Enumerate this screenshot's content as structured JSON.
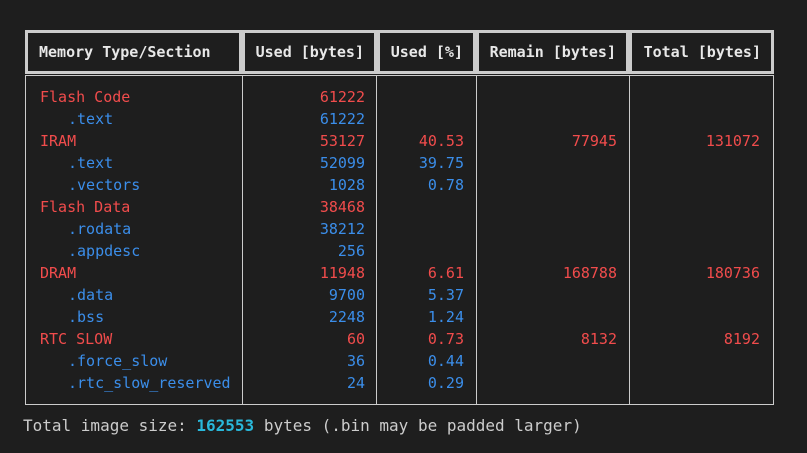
{
  "header": {
    "memory_type": "Memory Type/Section",
    "used_bytes": "Used [bytes]",
    "used_pct": "Used [%]",
    "remain_bytes": "Remain [bytes]",
    "total_bytes": "Total [bytes]"
  },
  "rows": [
    {
      "name": "Flash Code",
      "used": "61222",
      "pct": "",
      "remain": "",
      "total": "",
      "kind": "region"
    },
    {
      "name": ".text",
      "used": "61222",
      "pct": "",
      "remain": "",
      "total": "",
      "kind": "section"
    },
    {
      "name": "IRAM",
      "used": "53127",
      "pct": "40.53",
      "remain": "77945",
      "total": "131072",
      "kind": "region"
    },
    {
      "name": ".text",
      "used": "52099",
      "pct": "39.75",
      "remain": "",
      "total": "",
      "kind": "section"
    },
    {
      "name": ".vectors",
      "used": "1028",
      "pct": "0.78",
      "remain": "",
      "total": "",
      "kind": "section"
    },
    {
      "name": "Flash Data",
      "used": "38468",
      "pct": "",
      "remain": "",
      "total": "",
      "kind": "region"
    },
    {
      "name": ".rodata",
      "used": "38212",
      "pct": "",
      "remain": "",
      "total": "",
      "kind": "section"
    },
    {
      "name": ".appdesc",
      "used": "256",
      "pct": "",
      "remain": "",
      "total": "",
      "kind": "section"
    },
    {
      "name": "DRAM",
      "used": "11948",
      "pct": "6.61",
      "remain": "168788",
      "total": "180736",
      "kind": "region"
    },
    {
      "name": ".data",
      "used": "9700",
      "pct": "5.37",
      "remain": "",
      "total": "",
      "kind": "section"
    },
    {
      "name": ".bss",
      "used": "2248",
      "pct": "1.24",
      "remain": "",
      "total": "",
      "kind": "section"
    },
    {
      "name": "RTC SLOW",
      "used": "60",
      "pct": "0.73",
      "remain": "8132",
      "total": "8192",
      "kind": "region"
    },
    {
      "name": ".force_slow",
      "used": "36",
      "pct": "0.44",
      "remain": "",
      "total": "",
      "kind": "section"
    },
    {
      "name": ".rtc_slow_reserved",
      "used": "24",
      "pct": "0.29",
      "remain": "",
      "total": "",
      "kind": "section"
    }
  ],
  "footer": {
    "prefix": "Total image size: ",
    "total": "162553",
    "suffix": " bytes (.bin may be padded larger)"
  },
  "colors": {
    "region": "#f14c4c",
    "section": "#3b8eea",
    "total_highlight": "#29b8db",
    "border": "#cccccc",
    "background": "#1e1e1e"
  }
}
